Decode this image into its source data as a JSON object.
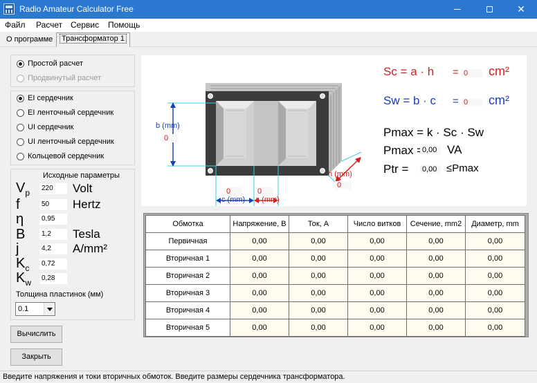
{
  "window": {
    "title": "Radio Amateur Calculator Free"
  },
  "menu": [
    "Файл",
    "Расчет",
    "Сервис",
    "Помощь"
  ],
  "tabs": {
    "about": "О программе",
    "transformer": "Трансформатор 1"
  },
  "mode": {
    "simple": "Простой расчет",
    "advanced": "Продвинутый расчет",
    "selected": "simple"
  },
  "core": {
    "options": [
      "EI сердечник",
      "EI ленточный сердечник",
      "UI сердечник",
      "UI ленточный сердечник",
      "Кольцевой сердечник"
    ],
    "selected": 0
  },
  "params": {
    "title": "Исходные параметры",
    "rows": [
      {
        "sym": "V",
        "sub": "p",
        "value": "220",
        "unit": "Volt"
      },
      {
        "sym": "f",
        "sub": "",
        "value": "50",
        "unit": "Hertz"
      },
      {
        "sym": "η",
        "sub": "",
        "value": "0,95",
        "unit": ""
      },
      {
        "sym": "B",
        "sub": "",
        "value": "1,2",
        "unit": "Tesla"
      },
      {
        "sym": "j",
        "sub": "",
        "value": "4,2",
        "unit": "A/mm²"
      },
      {
        "sym": "K",
        "sub": "c",
        "value": "0,72",
        "unit": ""
      },
      {
        "sym": "K",
        "sub": "w",
        "value": "0,28",
        "unit": ""
      }
    ],
    "thickness_label": "Толщина пластинок (мм)",
    "thickness_value": "0.1"
  },
  "buttons": {
    "calculate": "Вычислить",
    "close": "Закрыть"
  },
  "diagram": {
    "b_label": "b (mm)",
    "b_value": "0",
    "c_label": "c (mm)",
    "c_value": "0",
    "a_label": "a (mm)",
    "a_value": "0",
    "h_label": "h (mm)",
    "h_value": "0",
    "sc_left": "Sc = a · h",
    "sc_value": "0",
    "sc_unit": "cm²",
    "sw_left": "Sw = b · c",
    "sw_value": "0",
    "sw_unit": "cm²",
    "pmax_formula": "Pmax = k · Sc · Sw",
    "pmax_label": "Pmax =",
    "pmax_value": "0,00",
    "pmax_unit": "VA",
    "ptr_label": "Ptr  =",
    "ptr_value": "0,00",
    "ptr_suffix": "≤Pmax"
  },
  "table": {
    "headers": [
      "Обмотка",
      "Напряжение, В",
      "Ток, А",
      "Число витков",
      "Сечение, mm2",
      "Диаметр, mm"
    ],
    "rows": [
      [
        "Первичная",
        "0,00",
        "0,00",
        "0,00",
        "0,00",
        "0,00"
      ],
      [
        "Вторичная 1",
        "0,00",
        "0,00",
        "0,00",
        "0,00",
        "0,00"
      ],
      [
        "Вторичная 2",
        "0,00",
        "0,00",
        "0,00",
        "0,00",
        "0,00"
      ],
      [
        "Вторичная 3",
        "0,00",
        "0,00",
        "0,00",
        "0,00",
        "0,00"
      ],
      [
        "Вторичная 4",
        "0,00",
        "0,00",
        "0,00",
        "0,00",
        "0,00"
      ],
      [
        "Вторичная 5",
        "0,00",
        "0,00",
        "0,00",
        "0,00",
        "0,00"
      ]
    ]
  },
  "status": "Введите напряжения и токи вторичных обмоток. Введите размеры сердечника трансформатора."
}
